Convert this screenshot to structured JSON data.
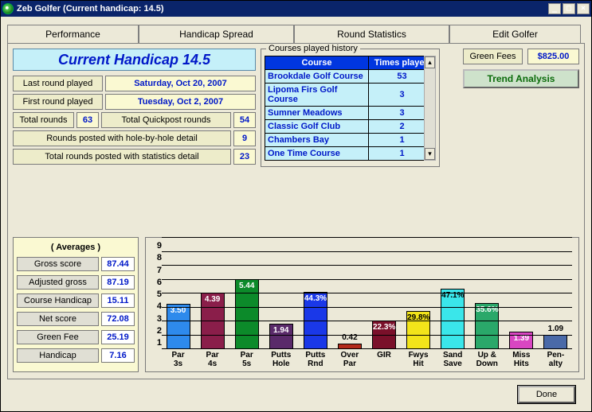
{
  "window": {
    "title": "Zeb Golfer (Current handicap: 14.5)"
  },
  "tabs": [
    "Performance",
    "Handicap Spread",
    "Round Statistics",
    "Edit Golfer"
  ],
  "handicap_banner": "Current Handicap 14.5",
  "stats": {
    "last_label": "Last round played",
    "last_val": "Saturday, Oct 20, 2007",
    "first_label": "First round played",
    "first_val": "Tuesday, Oct 2, 2007",
    "total_rounds_label": "Total rounds",
    "total_rounds": "63",
    "quickpost_label": "Total Quickpost rounds",
    "quickpost": "54",
    "hole_detail_label": "Rounds posted with hole-by-hole detail",
    "hole_detail": "9",
    "stat_detail_label": "Total rounds posted with statistics detail",
    "stat_detail": "23"
  },
  "courses": {
    "legend": "Courses played history",
    "headers": [
      "Course",
      "Times played"
    ],
    "rows": [
      {
        "name": "Brookdale Golf Course",
        "n": "53"
      },
      {
        "name": "Lipoma Firs Golf Course",
        "n": "3"
      },
      {
        "name": "Sumner Meadows",
        "n": "3"
      },
      {
        "name": "Classic Golf Club",
        "n": "2"
      },
      {
        "name": "Chambers Bay",
        "n": "1"
      },
      {
        "name": "One Time Course",
        "n": "1"
      }
    ]
  },
  "green_fees": {
    "label": "Green Fees",
    "value": "$825.00"
  },
  "trend_btn": "Trend Analysis",
  "averages": {
    "title": "( Averages )",
    "rows": [
      {
        "label": "Gross score",
        "val": "87.44"
      },
      {
        "label": "Adjusted gross",
        "val": "87.19"
      },
      {
        "label": "Course Handicap",
        "val": "15.11"
      },
      {
        "label": "Net score",
        "val": "72.08"
      },
      {
        "label": "Green Fee",
        "val": "25.19"
      },
      {
        "label": "Handicap",
        "val": "7.16"
      }
    ]
  },
  "done": "Done",
  "chart_data": {
    "type": "bar",
    "ylim": [
      0,
      9
    ],
    "yticks": [
      "9",
      "8",
      "7",
      "6",
      "5",
      "4",
      "3",
      "2",
      "1"
    ],
    "series": [
      {
        "label1": "Par",
        "label2": "3s",
        "value": 3.5,
        "disp": "3.50",
        "color": "#2e8aec",
        "h": 38.9
      },
      {
        "label1": "Par",
        "label2": "4s",
        "value": 4.39,
        "disp": "4.39",
        "color": "#8a1e4a",
        "h": 48.8
      },
      {
        "label1": "Par",
        "label2": "5s",
        "value": 5.44,
        "disp": "5.44",
        "color": "#0c8a2a",
        "h": 60.4
      },
      {
        "label1": "Putts",
        "label2": "Hole",
        "value": 1.94,
        "disp": "1.94",
        "color": "#5a2a6a",
        "h": 21.6
      },
      {
        "label1": "Putts",
        "label2": "Rnd",
        "value": 4.43,
        "disp": "44.3%",
        "color": "#1a38e8",
        "h": 49.2
      },
      {
        "label1": "Over",
        "label2": "Par",
        "value": 0.42,
        "disp": "0.42",
        "color": "#b22a1a",
        "h": 4.7
      },
      {
        "label1": "GIR",
        "label2": "",
        "value": 2.23,
        "disp": "22.3%",
        "color": "#7a102a",
        "h": 24.8
      },
      {
        "label1": "Fwys",
        "label2": "Hit",
        "value": 2.98,
        "disp": "29.8%",
        "color": "#f2e41a",
        "h": 33.1,
        "text": "#000"
      },
      {
        "label1": "Sand",
        "label2": "Save",
        "value": 4.71,
        "disp": "47.1%",
        "color": "#3ae6ea",
        "h": 52.3,
        "text": "#000"
      },
      {
        "label1": "Up &",
        "label2": "Down",
        "value": 3.56,
        "disp": "35.6%",
        "color": "#2aa86a",
        "h": 39.6
      },
      {
        "label1": "Miss",
        "label2": "Hits",
        "value": 1.39,
        "disp": "1.39",
        "color": "#d946c2",
        "h": 15.4
      },
      {
        "label1": "Pen-",
        "label2": "alty",
        "value": 1.09,
        "disp": "1.09",
        "color": "#4a6aa8",
        "h": 12.1
      }
    ]
  }
}
